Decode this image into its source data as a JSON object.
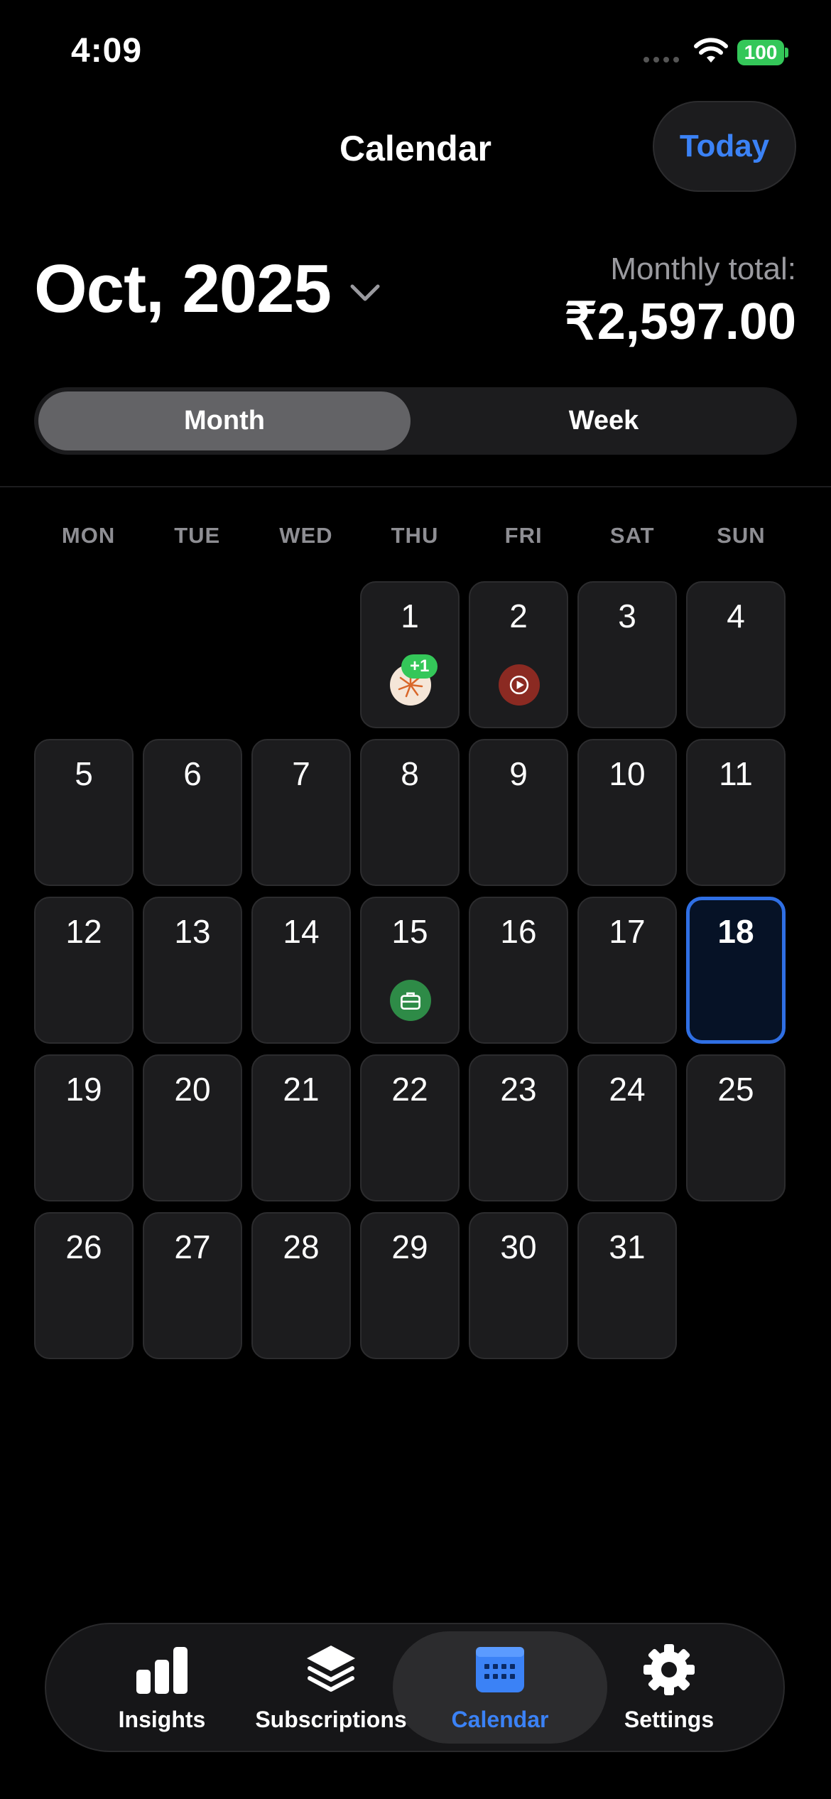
{
  "status_bar": {
    "time": "4:09",
    "battery": "100"
  },
  "header": {
    "title": "Calendar",
    "today_label": "Today"
  },
  "month_selector": {
    "label": "Oct, 2025"
  },
  "totals": {
    "label": "Monthly total:",
    "value": "₹2,597.00"
  },
  "view_toggle": {
    "options": [
      "Month",
      "Week"
    ],
    "selected": "Month"
  },
  "weekdays": [
    "MON",
    "TUE",
    "WED",
    "THU",
    "FRI",
    "SAT",
    "SUN"
  ],
  "calendar": {
    "leading_blanks": 3,
    "days": [
      "1",
      "2",
      "3",
      "4",
      "5",
      "6",
      "7",
      "8",
      "9",
      "10",
      "11",
      "12",
      "13",
      "14",
      "15",
      "16",
      "17",
      "18",
      "19",
      "20",
      "21",
      "22",
      "23",
      "24",
      "25",
      "26",
      "27",
      "28",
      "29",
      "30",
      "31"
    ],
    "today": "18",
    "subscriptions": [
      {
        "day": "1",
        "icon": "sunburst-logo-icon",
        "color": "#f5e6d8",
        "more_badge": "+1"
      },
      {
        "day": "2",
        "icon": "play-icon",
        "color": "#8b2a22"
      },
      {
        "day": "15",
        "icon": "briefcase-icon",
        "color": "#2e8b47"
      }
    ]
  },
  "tabs": [
    {
      "label": "Insights",
      "icon": "bar-chart-icon"
    },
    {
      "label": "Subscriptions",
      "icon": "layers-icon"
    },
    {
      "label": "Calendar",
      "icon": "calendar-icon",
      "active": true
    },
    {
      "label": "Settings",
      "icon": "gear-icon"
    }
  ],
  "colors": {
    "accent": "#3b82f6",
    "badge": "#34c759"
  }
}
